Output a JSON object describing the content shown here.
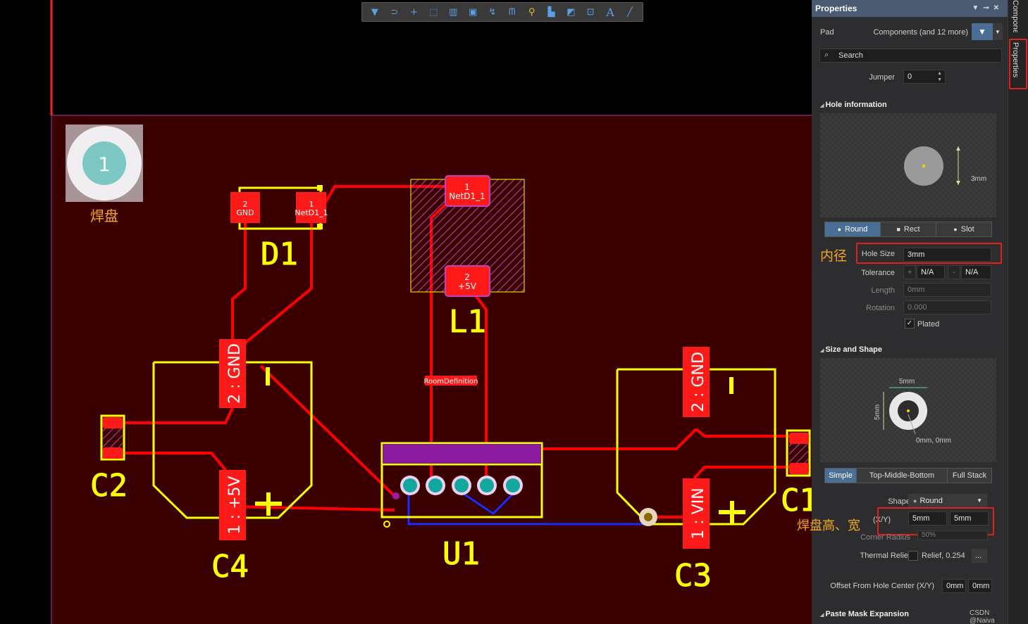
{
  "toolbar": {
    "icons": [
      "filter-icon",
      "route-icon",
      "plus-icon",
      "select-rect-icon",
      "chart-icon",
      "component-icon",
      "wire-icon",
      "arc-icon",
      "pin-icon",
      "layer-icon",
      "rect-route-icon",
      "measure-icon",
      "text-icon",
      "line-icon"
    ],
    "text_button_label": "A"
  },
  "board": {
    "bg_color": "#3a0000",
    "track_color": "#ff0000",
    "silk_color": "#ffff00",
    "pad_label_text": "焊盘",
    "big_pad_number": "1",
    "designators": {
      "d1": "D1",
      "l1": "L1",
      "c2": "C2",
      "c4": "C4",
      "u1": "U1",
      "c3": "C3",
      "c1": "C1"
    },
    "pads": {
      "d1_2": [
        "2",
        "GND"
      ],
      "d1_1": [
        "1",
        "NetD1_1"
      ],
      "l1_1": [
        "1",
        "NetD1_1"
      ],
      "l1_2": [
        "2",
        "+5V"
      ],
      "c4_2": "2 : GND",
      "c4_1": "1 : +5V",
      "c3_2": "2 : GND",
      "c3_1": "1 : VIN"
    },
    "room_label": "RoomDefinition"
  },
  "panel": {
    "title": "Properties",
    "object_type": "Pad",
    "filter_text": "Components (and 12 more)",
    "search_placeholder": "Search",
    "jumper_label": "Jumper",
    "jumper_value": "0",
    "hole_section": "Hole information",
    "hole_dim_label": "3mm",
    "hole_shapes": [
      "Round",
      "Rect",
      "Slot"
    ],
    "hole_shape_active": "Round",
    "hole_size_label": "Hole Size",
    "hole_size_value": "3mm",
    "tolerance_label": "Tolerance",
    "tolerance_plus_sign": "+",
    "tolerance_plus": "N/A",
    "tolerance_minus_sign": "-",
    "tolerance_minus": "N/A",
    "length_label": "Length",
    "length_value": "0mm",
    "rotation_label": "Rotation",
    "rotation_value": "0.000",
    "plated_label": "Plated",
    "size_section": "Size and Shape",
    "size_dim_x": "5mm",
    "size_dim_y": "5mm",
    "size_offset_label": "0mm, 0mm",
    "stack_modes": [
      "Simple",
      "Top-Middle-Bottom",
      "Full Stack"
    ],
    "stack_active": "Simple",
    "shape_label": "Shape",
    "shape_value": "Round",
    "xy_label": "(X/Y)",
    "size_x": "5mm",
    "size_y": "5mm",
    "corner_radius_label": "Corner Radius",
    "corner_radius_value": "50%",
    "thermal_label": "Thermal Relief",
    "thermal_value": "Relief, 0.254",
    "thermal_btn": "...",
    "offset_label": "Offset From Hole Center (X/Y)",
    "offset_x": "0mm",
    "offset_y": "0mm",
    "paste_section": "Paste Mask Expansion",
    "watermark": "CSDN @Naiva"
  },
  "annotations": {
    "inner_diameter": "内径",
    "pad_size": "焊盘高、宽"
  },
  "sidebar": {
    "tab_components": "Components",
    "tab_properties": "Properties"
  }
}
